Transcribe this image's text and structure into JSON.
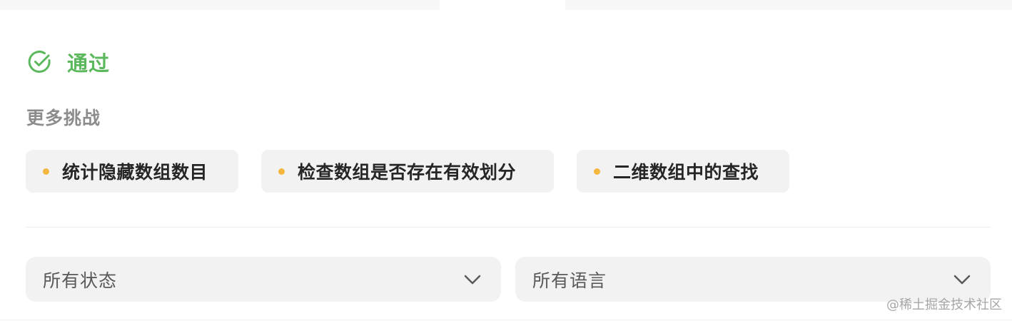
{
  "status": {
    "label": "通过",
    "icon": "check-circle-icon",
    "color": "#5cb85c"
  },
  "more_challenges": {
    "title": "更多挑战",
    "items": [
      {
        "label": "统计隐藏数组数目",
        "dot_color": "#f4b73e"
      },
      {
        "label": "检查数组是否存在有效划分",
        "dot_color": "#f4b73e"
      },
      {
        "label": "二维数组中的查找",
        "dot_color": "#f4b73e"
      }
    ]
  },
  "filters": {
    "status_select": {
      "value": "所有状态",
      "icon": "chevron-down-icon"
    },
    "language_select": {
      "value": "所有语言",
      "icon": "chevron-down-icon"
    }
  },
  "watermark": "@稀土掘金技术社区"
}
